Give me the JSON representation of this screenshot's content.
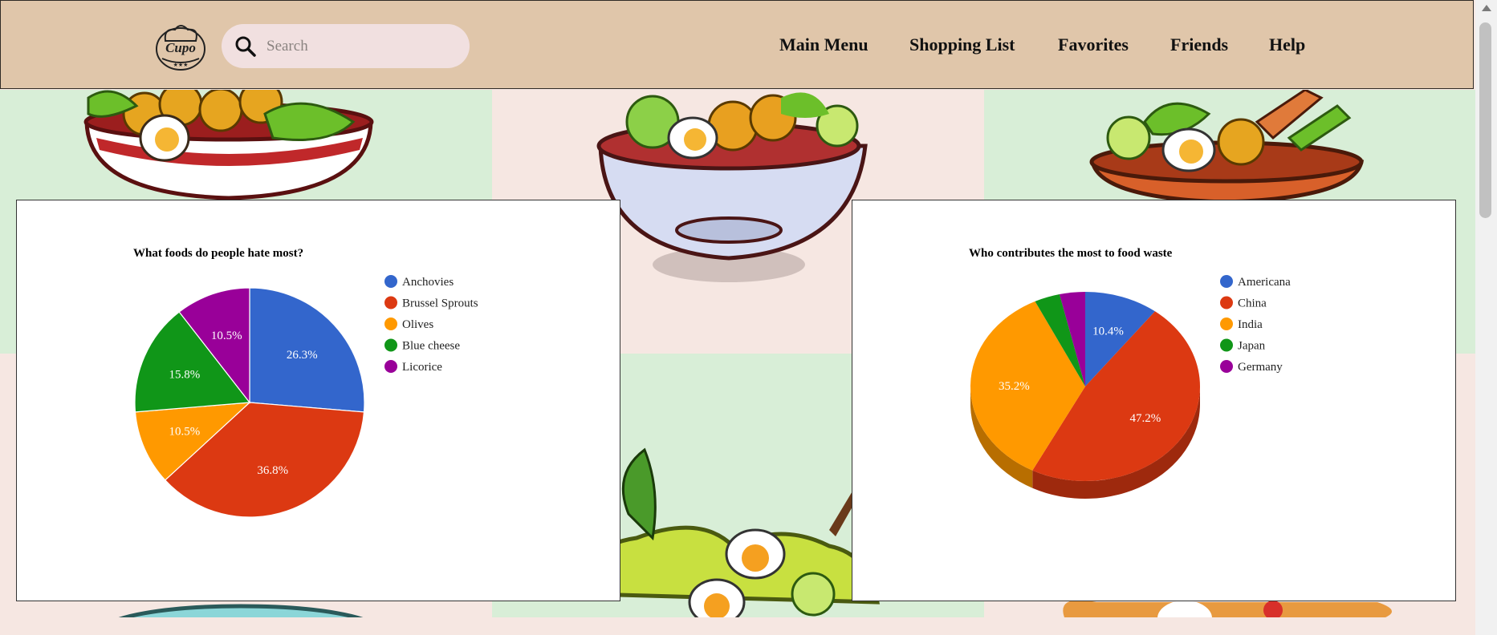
{
  "header": {
    "logo_text": "Cupo",
    "search_placeholder": "Search",
    "search_value": "",
    "nav": [
      "Main Menu",
      "Shopping List",
      "Favorites",
      "Friends",
      "Help"
    ]
  },
  "colors": {
    "header_bg": "#e0c6aa",
    "tile_green": "#d8eed7",
    "tile_pink": "#f6e7e2",
    "blue": "#3366cc",
    "red": "#dc3912",
    "orange": "#ff9900",
    "green": "#109618",
    "purple": "#990099"
  },
  "chart_data": [
    {
      "type": "pie",
      "title": "What foods do people hate most?",
      "legend_position": "right",
      "slices": [
        {
          "label": "Anchovies",
          "value": 26.3,
          "color": "#3366cc"
        },
        {
          "label": "Brussel Sprouts",
          "value": 36.8,
          "color": "#dc3912"
        },
        {
          "label": "Olives",
          "value": 10.5,
          "color": "#ff9900"
        },
        {
          "label": "Blue cheese",
          "value": 15.8,
          "color": "#109618"
        },
        {
          "label": "Licorice",
          "value": 10.5,
          "color": "#990099"
        }
      ]
    },
    {
      "type": "pie",
      "title": "Who contributes the most to food waste",
      "style": "3d",
      "legend_position": "right",
      "slices": [
        {
          "label": "Americana",
          "value": 10.4,
          "color": "#3366cc"
        },
        {
          "label": "China",
          "value": 47.2,
          "color": "#dc3912"
        },
        {
          "label": "India",
          "value": 35.2,
          "color": "#ff9900"
        },
        {
          "label": "Japan",
          "value": 3.6,
          "color": "#109618"
        },
        {
          "label": "Germany",
          "value": 3.6,
          "color": "#990099"
        }
      ]
    }
  ]
}
